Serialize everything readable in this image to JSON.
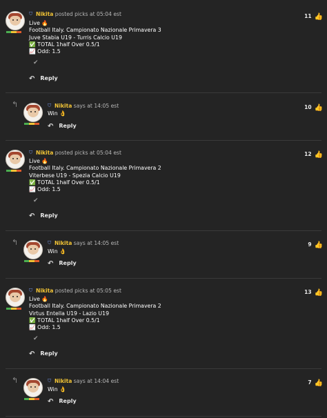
{
  "posts": [
    {
      "user": "Nikita",
      "action": "posted picks at 05:04 est",
      "lines": [
        "Live 🔥",
        "Football Italy. Campionato Nazionale Primavera 3",
        "Juve Stabia U19 - Turris Calcio U19",
        "✅ TOTAL 1half Over 0.5/1",
        "📈 Odd: 1.5"
      ],
      "likes": "11",
      "reply": "Reply"
    },
    {
      "user": "Nikita",
      "action": "says at 14:05 est",
      "lines": [
        "Win 👌"
      ],
      "likes": "10",
      "reply": "Reply"
    },
    {
      "user": "Nikita",
      "action": "posted picks at 05:04 est",
      "lines": [
        "Live 🔥",
        "Football Italy. Campionato Nazionale Primavera 2",
        "Viterbese U19 - Spezia Calcio U19",
        "✅ TOTAL 1half Over 0.5/1",
        "📈 Odd: 1.5"
      ],
      "likes": "12",
      "reply": "Reply"
    },
    {
      "user": "Nikita",
      "action": "says at 14:05 est",
      "lines": [
        "Win 👌"
      ],
      "likes": "9",
      "reply": "Reply"
    },
    {
      "user": "Nikita",
      "action": "posted picks at 05:05 est",
      "lines": [
        "Live 🔥",
        "Football Italy. Campionato Nazionale Primavera 2",
        "Virtus Entella U19 - Lazio U19",
        "✅ TOTAL 1half Over 0.5/1",
        "📈 Odd: 1.5"
      ],
      "likes": "13",
      "reply": "Reply"
    },
    {
      "user": "Nikita",
      "action": "says at 14:04 est",
      "lines": [
        "Win 👌"
      ],
      "likes": "7",
      "reply": "Reply"
    }
  ],
  "icons": {
    "badge": "shield-badge-icon",
    "check": "checkmark-icon",
    "reply": "reply-arrow-icon",
    "like": "thumbs-up-icon",
    "nested": "nested-reply-arrow-icon"
  },
  "colors": {
    "background": "#242424",
    "username": "#f2c436",
    "like_icon": "#f2c436",
    "level_bar": [
      "#4caf50",
      "#f2c436",
      "#e25b2b"
    ]
  }
}
